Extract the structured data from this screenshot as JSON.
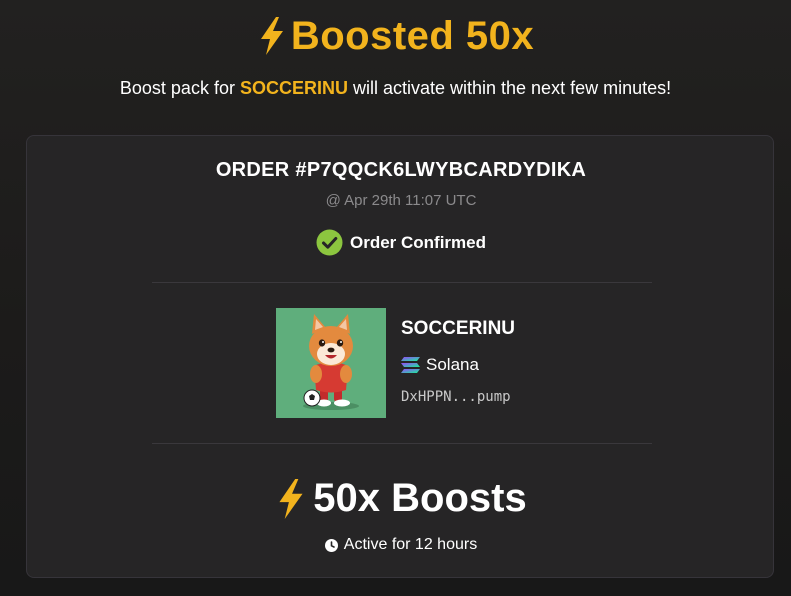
{
  "header": {
    "icon": "lightning-bolt-icon",
    "title": "Boosted 50x",
    "subtitle_prefix": "Boost pack for ",
    "subtitle_token": "SOCCERINU",
    "subtitle_suffix": " will activate within the next few minutes!"
  },
  "order": {
    "id_label": "ORDER #P7QQCK6LWYBCARDYDIKA",
    "timestamp": "@ Apr 29th 11:07 UTC",
    "status_icon": "check-circle-icon",
    "status": "Order Confirmed"
  },
  "token": {
    "image": "token-logo-image",
    "name": "SOCCERINU",
    "chain_icon": "solana-icon",
    "chain": "Solana",
    "address": "DxHPPN...pump"
  },
  "boost": {
    "icon": "lightning-bolt-icon",
    "count_label": "50x Boosts",
    "duration_icon": "clock-icon",
    "duration": "Active for 12 hours"
  },
  "colors": {
    "accent": "#f2b31d",
    "success": "#8cc63f",
    "background": "#1e1d1c",
    "card": "#262526",
    "muted_text": "#8b8a8c",
    "token_image_bg": "#5fae7c"
  }
}
